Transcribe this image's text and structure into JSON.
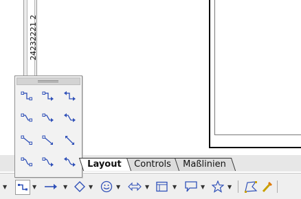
{
  "ruler": {
    "label": "24232221 2"
  },
  "tabs": [
    {
      "label": "Layout",
      "active": true
    },
    {
      "label": "Controls",
      "active": false
    },
    {
      "label": "Maßlinien",
      "active": false
    }
  ],
  "popup_icons": [
    [
      "connector-standard-icon",
      "connector-standard-arrow-end-icon",
      "connector-standard-arrows-icon"
    ],
    [
      "connector-line-icon",
      "connector-line-arrow-end-icon",
      "connector-line-arrows-icon"
    ],
    [
      "connector-straight-icon",
      "connector-straight-arrow-end-icon",
      "connector-straight-arrows-icon"
    ],
    [
      "connector-curved-icon",
      "connector-curved-arrow-end-icon",
      "connector-curved-arrows-icon"
    ]
  ],
  "toolbar": {
    "items": [
      "connector-icon",
      "line-arrow-icon",
      "basic-shapes-icon",
      "symbol-shapes-icon",
      "block-arrows-icon",
      "flowchart-icon",
      "callouts-icon",
      "stars-icon",
      "points-icon",
      "extrusion-icon"
    ]
  },
  "colors": {
    "icon_blue": "#2f50b8",
    "popup_bg": "#f2f2f2",
    "strip_bg": "#e7e7e7"
  }
}
